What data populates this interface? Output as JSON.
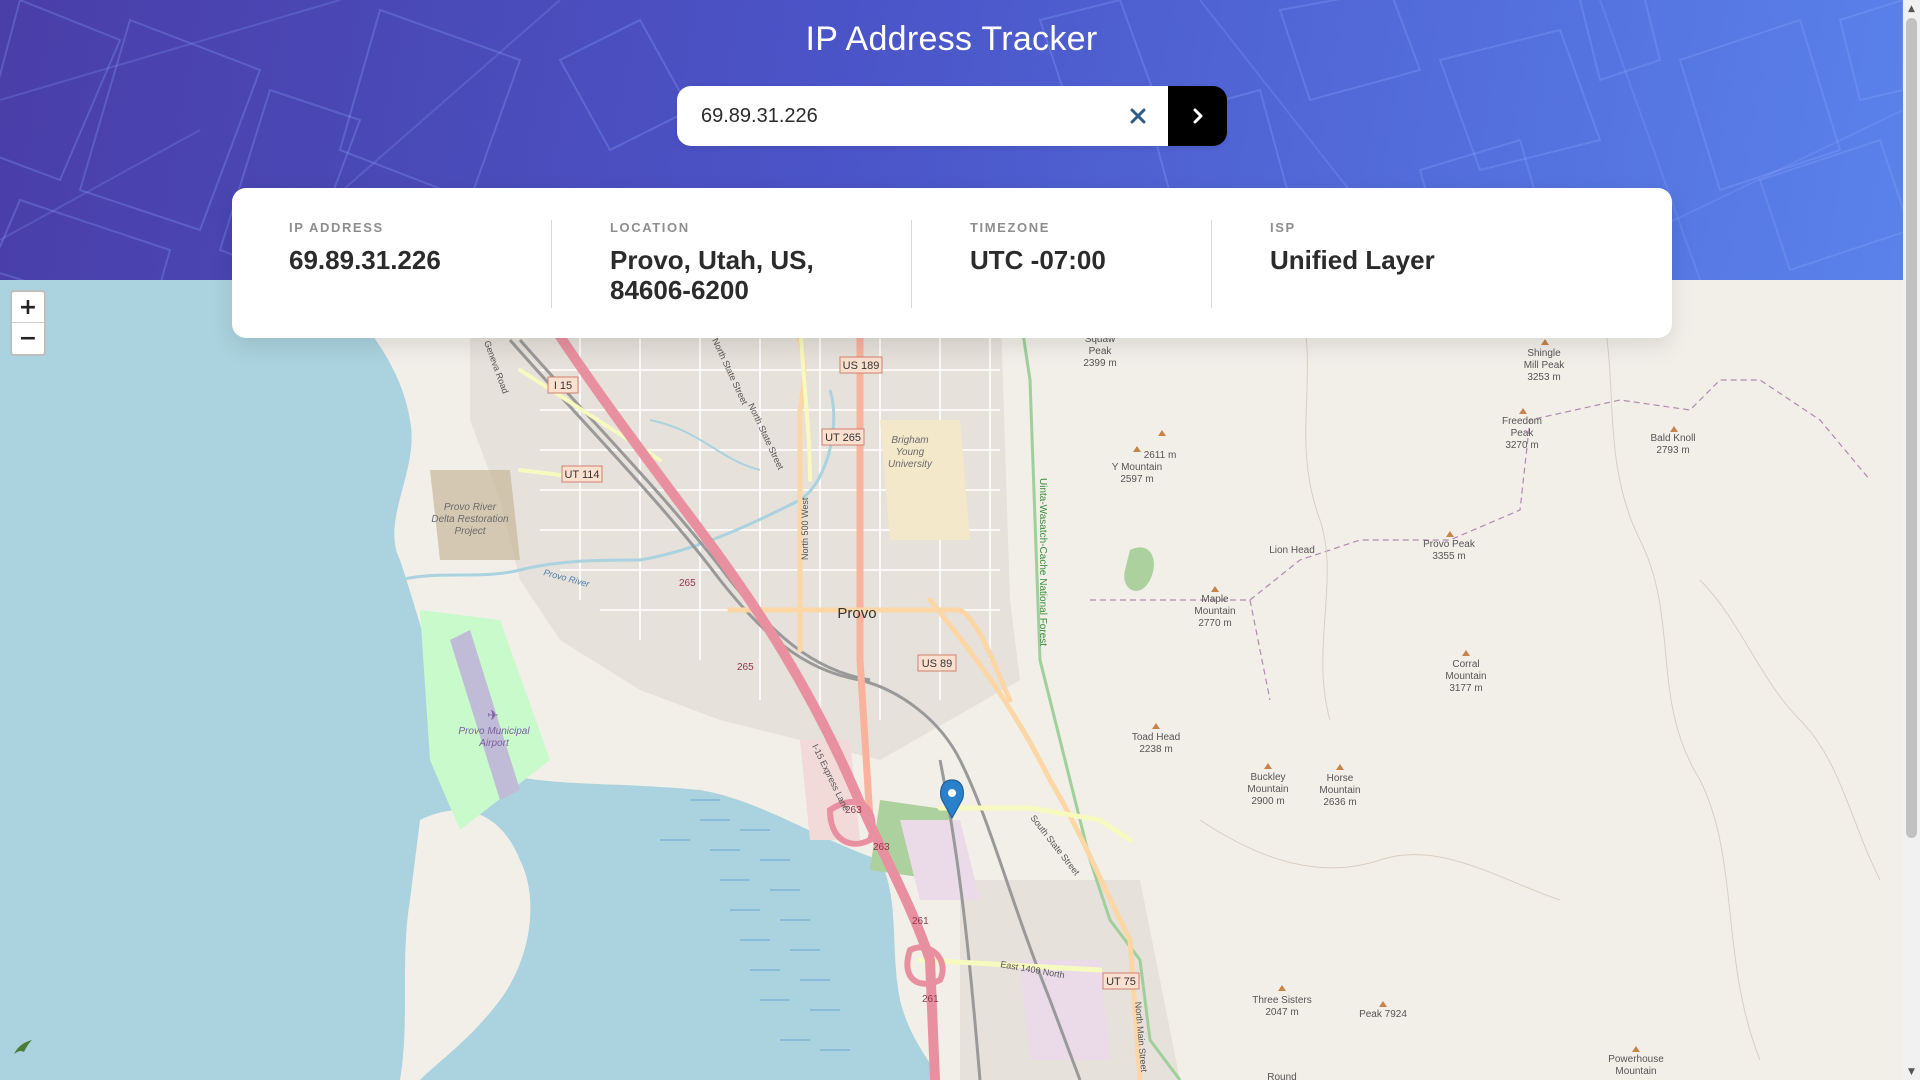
{
  "app": {
    "title": "IP Address Tracker"
  },
  "search": {
    "value": "69.89.31.226",
    "clear_icon": "close-icon",
    "submit_icon": "chevron-right-icon"
  },
  "info": {
    "ip": {
      "label": "IP ADDRESS",
      "value": "69.89.31.226"
    },
    "location": {
      "label": "LOCATION",
      "value_line1": "Provo, Utah, US,",
      "value_line2": "84606-6200"
    },
    "timezone": {
      "label": "TIMEZONE",
      "value": "UTC -07:00"
    },
    "isp": {
      "label": "ISP",
      "value": "Unified Layer"
    }
  },
  "map": {
    "zoom_in": "+",
    "zoom_out": "−",
    "city": "Provo",
    "highway_shields": [
      "I 15",
      "US 189",
      "UT 265",
      "UT 114",
      "US 89",
      "UT 75"
    ],
    "route_numbers": [
      "265",
      "265",
      "263",
      "263",
      "261",
      "261"
    ],
    "place_labels": {
      "byu": [
        "Brigham",
        "Young",
        "University"
      ],
      "delta": [
        "Provo River",
        "Delta Restoration",
        "Project"
      ],
      "airport": [
        "Provo Municipal",
        "Airport"
      ],
      "forest": "Uinta-Wasatch-Cache National Forest",
      "north_500_west": "North 500 West",
      "north_state_street": "North State Street",
      "south_state_street": "South State Street",
      "north_main_street": "North Main Street",
      "i15_express_lane": "I-15 Express Lane",
      "east_1400_north": "East 1400 North",
      "geneva_road": "Geneva Road",
      "provo_river": "Provo River"
    },
    "peaks": [
      {
        "name": [
          "Squaw",
          "Peak",
          "2399 m"
        ]
      },
      {
        "name": [
          "2611 m"
        ]
      },
      {
        "name": [
          "Y Mountain",
          "2597 m"
        ]
      },
      {
        "name": [
          "Shingle",
          "Mill Peak",
          "3253 m"
        ]
      },
      {
        "name": [
          "Freedom",
          "Peak",
          "3270 m"
        ]
      },
      {
        "name": [
          "Bald Knoll",
          "2793 m"
        ]
      },
      {
        "name": [
          "Lion Head"
        ]
      },
      {
        "name": [
          "Provo Peak",
          "3355 m"
        ]
      },
      {
        "name": [
          "Maple",
          "Mountain",
          "2770 m"
        ]
      },
      {
        "name": [
          "Corral",
          "Mountain",
          "3177 m"
        ]
      },
      {
        "name": [
          "Toad Head",
          "2238 m"
        ]
      },
      {
        "name": [
          "Buckley",
          "Mountain",
          "2900 m"
        ]
      },
      {
        "name": [
          "Horse",
          "Mountain",
          "2636 m"
        ]
      },
      {
        "name": [
          "Three Sisters",
          "2047 m"
        ]
      },
      {
        "name": [
          "Peak 7924"
        ]
      },
      {
        "name": [
          "Powerhouse",
          "Mountain"
        ]
      },
      {
        "name": [
          "Round"
        ]
      }
    ],
    "marker_icon": "map-pin-icon",
    "attribution_icon": "leaflet-icon",
    "colors": {
      "water": "#aad3df",
      "land": "#f2efe9",
      "motorway": "#e990a0",
      "trunk": "#f9b29c",
      "primary": "#fcd6a4",
      "park": "#c8facc",
      "marker": "#2a81cb"
    }
  }
}
